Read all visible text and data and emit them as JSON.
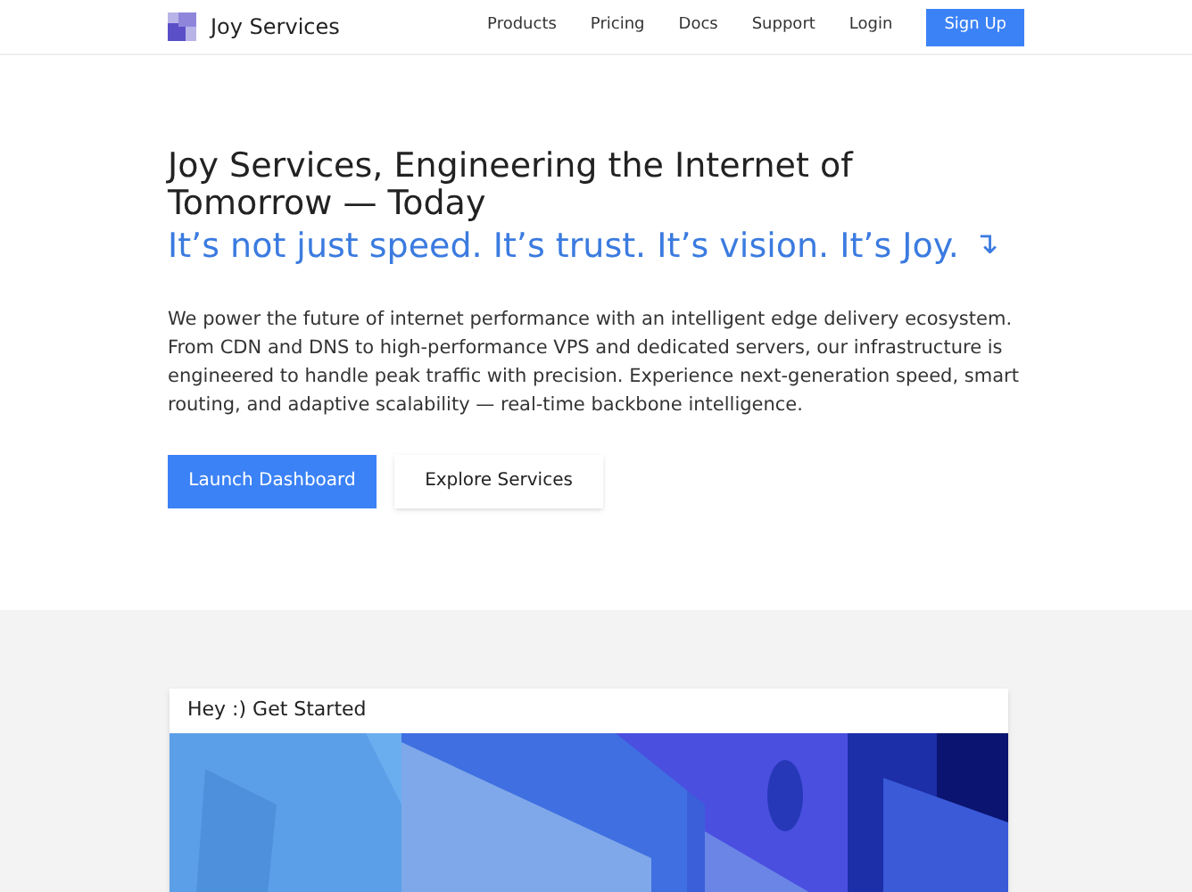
{
  "brand": {
    "name": "Joy Services"
  },
  "nav": {
    "links": [
      {
        "label": "Products"
      },
      {
        "label": "Pricing"
      },
      {
        "label": "Docs"
      },
      {
        "label": "Support"
      },
      {
        "label": "Login"
      }
    ],
    "cta": "Sign Up"
  },
  "hero": {
    "title": "Joy Services, Engineering the Internet of Tomorrow — Today",
    "tagline": "It’s not just speed. It’s trust. It’s vision. It’s Joy.",
    "tagline_icon": "↴",
    "body": "We power the future of internet performance with an intelligent edge delivery ecosystem. From CDN and DNS to high-performance VPS and dedicated servers, our infrastructure is engineered to handle peak traffic with precision. Experience next-generation speed, smart routing, and adaptive scalability — real-time backbone intelligence.",
    "buttons": [
      {
        "label": "Launch Dashboard",
        "kind": "primary"
      },
      {
        "label": "Explore Services",
        "kind": "secondary"
      }
    ]
  },
  "card": {
    "title": "Hey :) Get Started"
  }
}
